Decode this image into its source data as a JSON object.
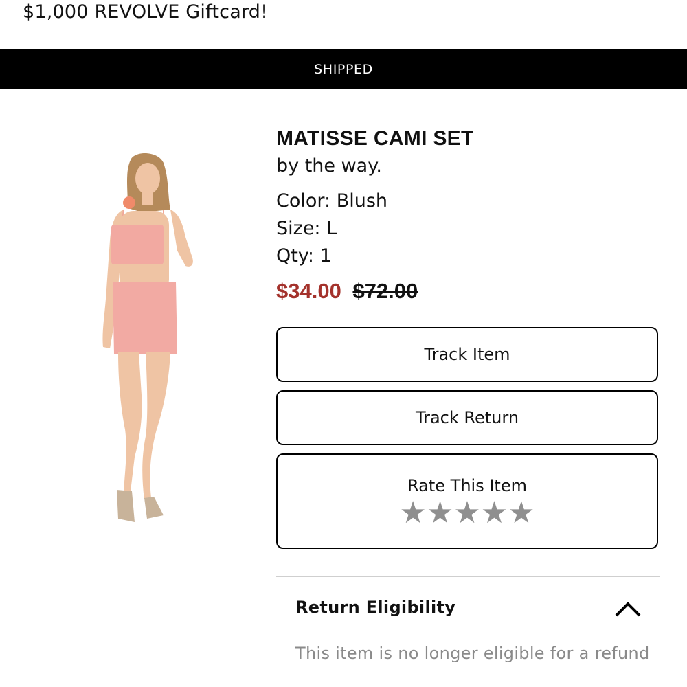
{
  "promo": {
    "text": "$1,000 REVOLVE Giftcard!"
  },
  "status": {
    "label": "SHIPPED"
  },
  "product": {
    "name": "MATISSE CAMI SET",
    "brand": "by the way.",
    "color": "Color: Blush",
    "size": "Size: L",
    "qty": "Qty: 1",
    "sale_price": "$34.00",
    "original_price": "$72.00",
    "image_alt": "Model wearing blush cami top and mini skirt"
  },
  "actions": {
    "track_item": "Track Item",
    "track_return": "Track Return",
    "rate_item": "Rate This Item",
    "rating_star": "★",
    "rating_stars_filled": 0,
    "rating_stars_total": 5
  },
  "return_eligibility": {
    "title": "Return Eligibility",
    "message": "This item is no longer eligible for a refund",
    "expanded": true
  },
  "colors": {
    "sale_price": "#a4322c",
    "status_bar": "#000000",
    "star_inactive": "#8f8f8f",
    "muted_text": "#8a8a8a"
  }
}
